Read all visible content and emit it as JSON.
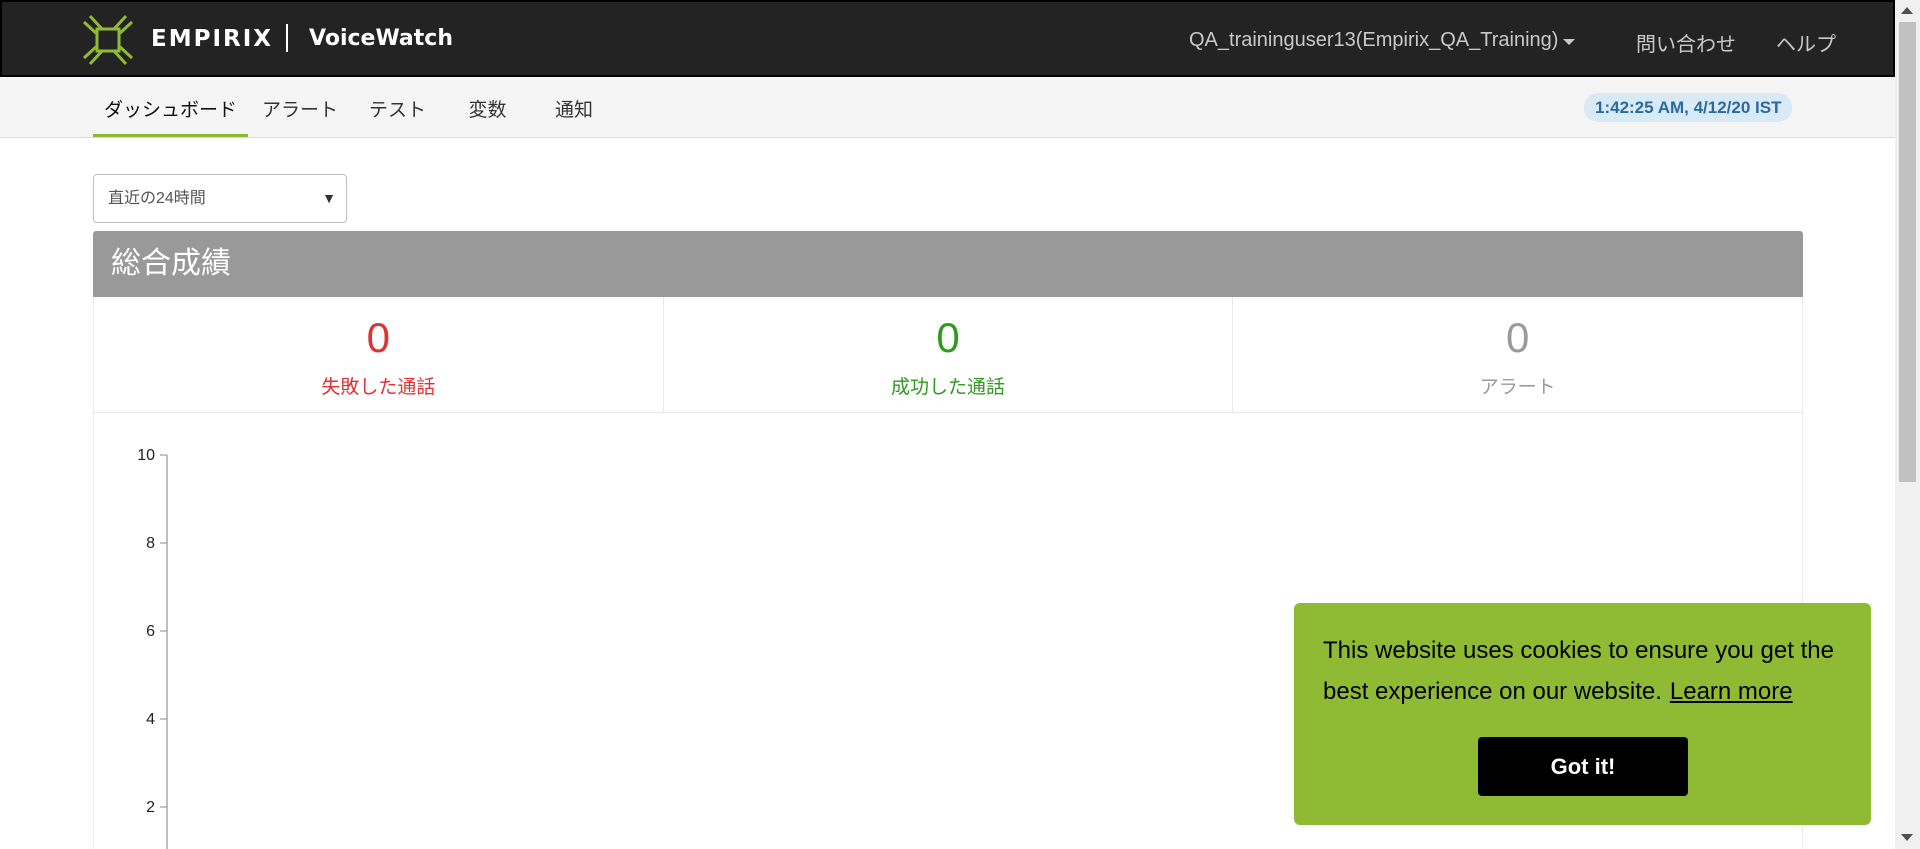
{
  "header": {
    "brand": "EMPIRIX",
    "product": "VoiceWatch",
    "user": "QA_traininguser13(Empirix_QA_Training)",
    "links": [
      "問い合わせ",
      "ヘルプ"
    ]
  },
  "tabs": [
    {
      "label": "ダッシュボード",
      "active": true
    },
    {
      "label": "アラート",
      "active": false
    },
    {
      "label": "テスト",
      "active": false
    },
    {
      "label": "変数",
      "active": false
    },
    {
      "label": "通知",
      "active": false
    }
  ],
  "timestamp": "1:42:25 AM, 4/12/20 IST",
  "range_select": {
    "value": "直近の24時間"
  },
  "panel": {
    "title": "総合成績",
    "stats": [
      {
        "value": "0",
        "label": "失敗した通話",
        "color": "#e03232"
      },
      {
        "value": "0",
        "label": "成功した通話",
        "color": "#2f9a1e"
      },
      {
        "value": "0",
        "label": "アラート",
        "color": "#9a9a9a"
      }
    ]
  },
  "chart_data": {
    "type": "line",
    "y_ticks": [
      "10",
      "8",
      "6",
      "4",
      "2"
    ],
    "ylim": [
      0,
      10
    ],
    "series": []
  },
  "cookie": {
    "text": "This website uses cookies to ensure you get the best experience on our website.",
    "link": "Learn more",
    "button": "Got it!",
    "bg_color": "#8fba33"
  },
  "colors": {
    "accent": "#8aba2f",
    "header_bg": "#232323"
  }
}
